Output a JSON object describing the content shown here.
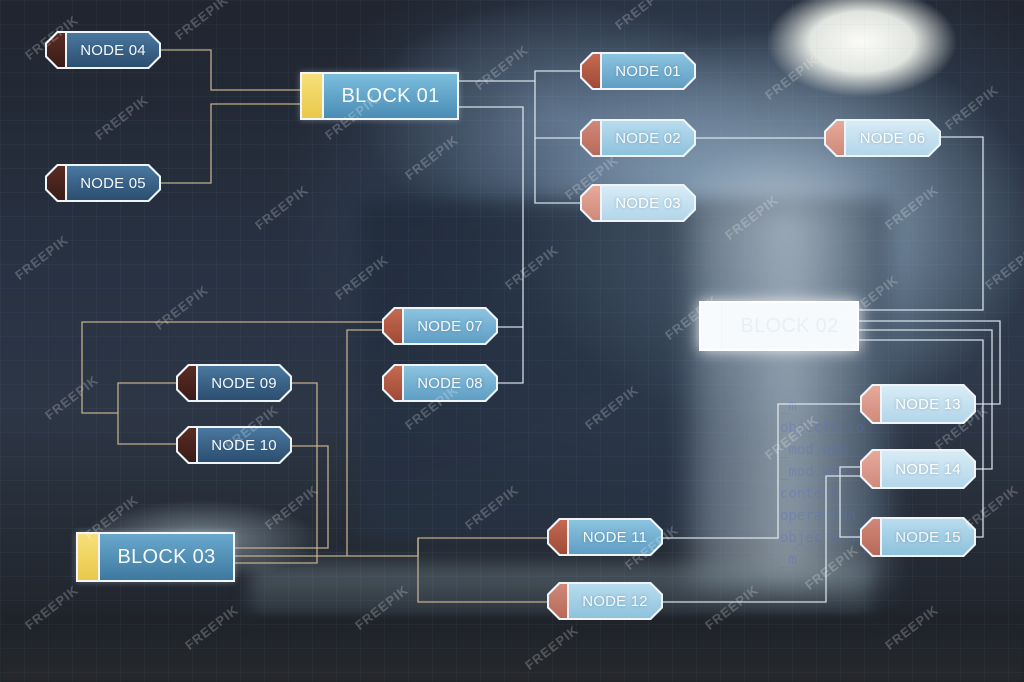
{
  "diagram": {
    "blocks": [
      {
        "id": "block-01",
        "label": "BLOCK 01"
      },
      {
        "id": "block-02",
        "label": "BLOCK 02"
      },
      {
        "id": "block-03",
        "label": "BLOCK 03"
      }
    ],
    "nodes": [
      {
        "id": "node-01",
        "label": "NODE 01"
      },
      {
        "id": "node-02",
        "label": "NODE 02"
      },
      {
        "id": "node-03",
        "label": "NODE 03"
      },
      {
        "id": "node-04",
        "label": "NODE 04"
      },
      {
        "id": "node-05",
        "label": "NODE 05"
      },
      {
        "id": "node-06",
        "label": "NODE 06"
      },
      {
        "id": "node-07",
        "label": "NODE 07"
      },
      {
        "id": "node-08",
        "label": "NODE 08"
      },
      {
        "id": "node-09",
        "label": "NODE 09"
      },
      {
        "id": "node-10",
        "label": "NODE 10"
      },
      {
        "id": "node-11",
        "label": "NODE 11"
      },
      {
        "id": "node-12",
        "label": "NODE 12"
      },
      {
        "id": "node-13",
        "label": "NODE 13"
      },
      {
        "id": "node-14",
        "label": "NODE 14"
      },
      {
        "id": "node-15",
        "label": "NODE 15"
      }
    ],
    "edges": [
      {
        "from": "node-04",
        "to": "block-01"
      },
      {
        "from": "node-05",
        "to": "block-01"
      },
      {
        "from": "block-01",
        "to": "node-01"
      },
      {
        "from": "block-01",
        "to": "node-02"
      },
      {
        "from": "block-01",
        "to": "node-03"
      },
      {
        "from": "block-01",
        "to": "node-08"
      },
      {
        "from": "node-02",
        "to": "node-06"
      },
      {
        "from": "node-06",
        "to": "block-02"
      },
      {
        "from": "block-02",
        "to": "node-13"
      },
      {
        "from": "block-02",
        "to": "node-14"
      },
      {
        "from": "block-02",
        "to": "node-15"
      },
      {
        "from": "node-07",
        "to": "node-09"
      },
      {
        "from": "node-07",
        "to": "node-10"
      },
      {
        "from": "node-07",
        "to": "node-08"
      },
      {
        "from": "block-03",
        "to": "node-09"
      },
      {
        "from": "block-03",
        "to": "node-10"
      },
      {
        "from": "block-03",
        "to": "node-07"
      },
      {
        "from": "block-03",
        "to": "node-11"
      },
      {
        "from": "block-03",
        "to": "node-12"
      },
      {
        "from": "node-11",
        "to": "node-13"
      },
      {
        "from": "node-12",
        "to": "node-14"
      },
      {
        "from": "node-14",
        "to": "node-15"
      }
    ]
  },
  "background": {
    "code_overlay": [
      "_m",
      "objects lo",
      "_mod.use",
      "_mod.use",
      "context",
      "operation",
      "objects.ne",
      "_m"
    ],
    "watermark": "FREEPIK"
  },
  "colors": {
    "wire_gold": "#c9b48e",
    "wire_white": "#e6eef5",
    "block_accent": "#f0d35e",
    "node_accent": "#b85a44",
    "node_fill": "#8cc4e0"
  }
}
